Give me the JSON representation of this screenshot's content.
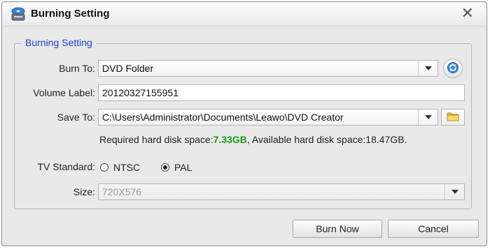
{
  "window": {
    "title": "Burning Setting",
    "icon": "disc-burner-icon",
    "close_glyph": "✕"
  },
  "group": {
    "legend": "Burning Setting"
  },
  "burn_to": {
    "label": "Burn To:",
    "value": "DVD Folder"
  },
  "volume_label": {
    "label": "Volume Label:",
    "value": "20120327155951"
  },
  "save_to": {
    "label": "Save To:",
    "value": "C:\\Users\\Administrator\\Documents\\Leawo\\DVD Creator"
  },
  "disk_space": {
    "required_label": "Required hard disk space:",
    "required_value": "7.33GB",
    "available_text": ", Available hard disk space:18.47GB."
  },
  "tv_standard": {
    "label": "TV Standard:",
    "options": [
      "NTSC",
      "PAL"
    ],
    "selected": "PAL"
  },
  "size": {
    "label": "Size:",
    "value": "720X576"
  },
  "buttons": {
    "burn_now": "Burn Now",
    "cancel": "Cancel"
  },
  "colors": {
    "legend": "#1a3fd6",
    "required_value": "#1b9a1b"
  }
}
